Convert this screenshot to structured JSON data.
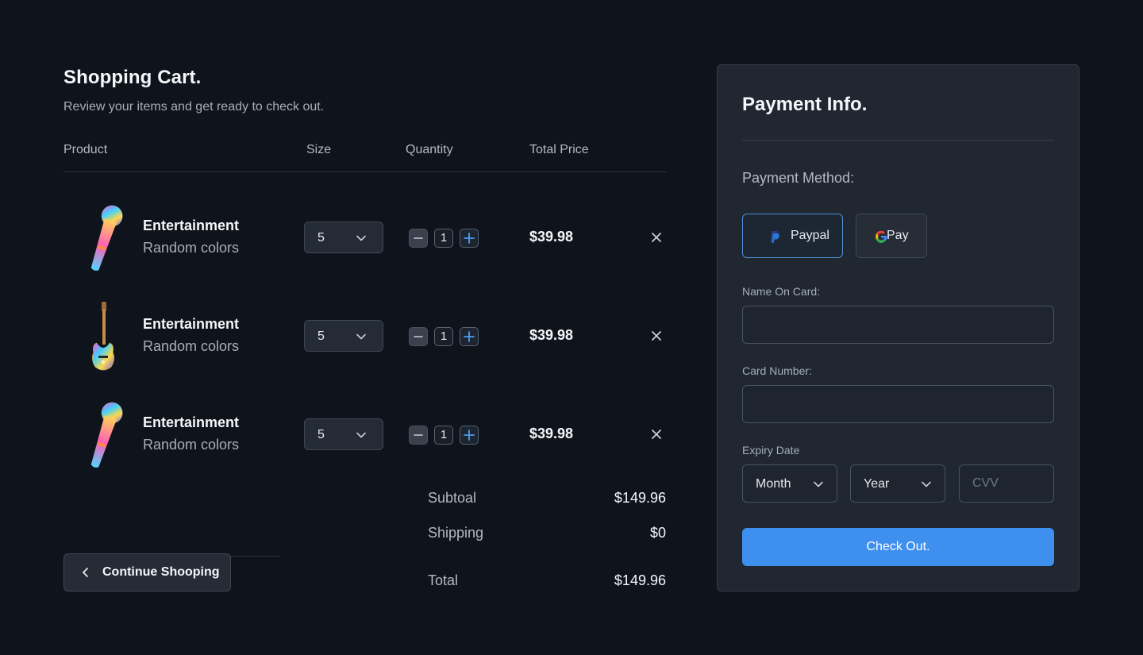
{
  "cart": {
    "title": "Shopping Cart.",
    "subtitle": "Review your items and get ready to check out.",
    "columns": {
      "product": "Product",
      "size": "Size",
      "quantity": "Quantity",
      "total": "Total Price"
    },
    "items": [
      {
        "name": "Entertainment",
        "variant": "Random colors",
        "size": "5",
        "quantity": "1",
        "price": "$39.98",
        "icon": "microphone-icon"
      },
      {
        "name": "Entertainment",
        "variant": "Random colors",
        "size": "5",
        "quantity": "1",
        "price": "$39.98",
        "icon": "guitar-icon"
      },
      {
        "name": "Entertainment",
        "variant": "Random colors",
        "size": "5",
        "quantity": "1",
        "price": "$39.98",
        "icon": "microphone-icon"
      }
    ],
    "summary": {
      "subtotal_label": "Subtoal",
      "subtotal": "$149.96",
      "shipping_label": "Shipping",
      "shipping": "$0",
      "total_label": "Total",
      "total": "$149.96"
    },
    "continue_label": "Continue Shooping"
  },
  "payment": {
    "title": "Payment Info.",
    "method_label": "Payment Method:",
    "methods": {
      "paypal": "Paypal",
      "gpay": "Pay"
    },
    "name_label": "Name On Card:",
    "name_value": "",
    "card_label": "Card Number:",
    "card_value": "",
    "expiry_label": "Expiry Date",
    "month": "Month",
    "year": "Year",
    "cvv_placeholder": "CVV",
    "checkout_label": "Check Out."
  },
  "colors": {
    "accent": "#3f8fef",
    "background": "#0f141c",
    "panel": "#202730"
  }
}
